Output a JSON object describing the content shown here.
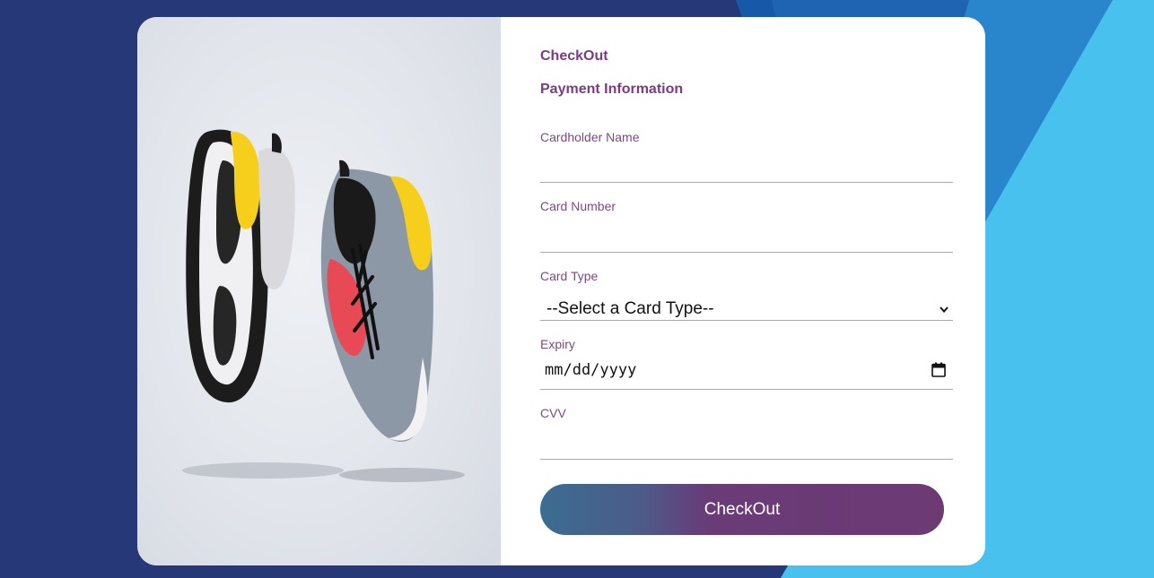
{
  "photo": {
    "alt": "product-photo-sneakers"
  },
  "checkout": {
    "title": "CheckOut",
    "section_title": "Payment Information",
    "cardholder_label": "Cardholder Name",
    "cardholder_value": "",
    "card_number_label": "Card Number",
    "card_number_value": "",
    "card_type_label": "Card Type",
    "card_type_selected": "--Select a Card Type--",
    "expiry_label": "Expiry",
    "expiry_placeholder": "mm/dd/yyyy",
    "cvv_label": "CVV",
    "cvv_value": "",
    "button_label": "CheckOut"
  },
  "colors": {
    "page_bg": "#263877",
    "accent_purple": "#7a3c80",
    "button_start": "#3b6d92",
    "button_end": "#6d3a74",
    "stripe_light": "#48c1ee",
    "stripe_mid": "#2a86cc"
  },
  "icons": {
    "select_arrow": "chevron-down-icon",
    "date_picker": "calendar-icon"
  }
}
